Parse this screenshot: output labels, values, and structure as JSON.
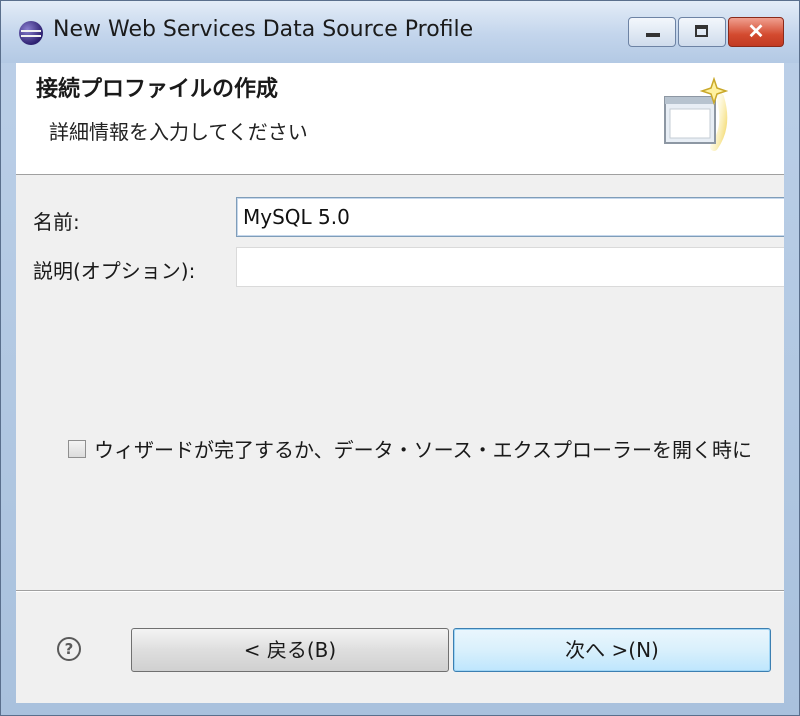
{
  "window": {
    "title": "New Web Services Data Source Profile"
  },
  "banner": {
    "title": "接続プロファイルの作成",
    "description": "詳細情報を入力してください"
  },
  "form": {
    "name_label": "名前:",
    "name_value": "MySQL 5.0",
    "description_label": "説明(オプション):",
    "description_value": ""
  },
  "options": {
    "connect_checkbox_label": "ウィザードが完了するか、データ・ソース・エクスプローラーを開く時に",
    "connect_checkbox_checked": false
  },
  "buttons": {
    "help_glyph": "?",
    "back_label": "< 戻る(B)",
    "next_label": "次へ >(N)"
  },
  "icons": {
    "app": "eclipse-icon",
    "wizard": "new-window-sparkle-icon",
    "help": "help-icon"
  },
  "colors": {
    "titlebar": "#c3d5ec",
    "close_button": "#d34a2f",
    "dialog_background": "#f0f0f0",
    "default_button": "#d9f0fc"
  }
}
